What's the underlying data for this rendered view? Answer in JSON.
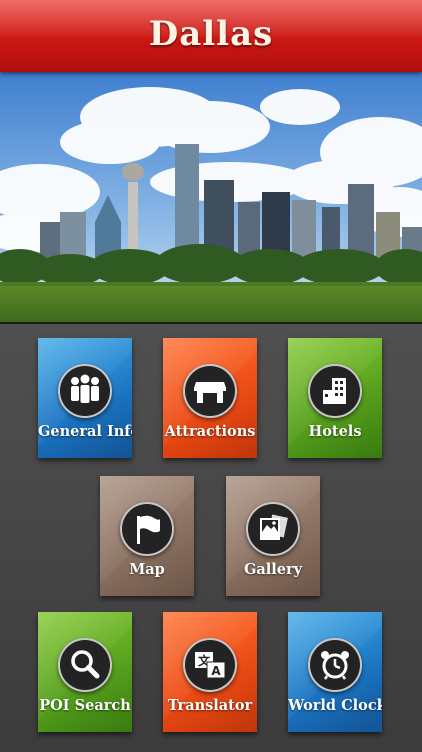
{
  "header": {
    "title": "Dallas"
  },
  "hero": {
    "alt": "Dallas skyline"
  },
  "tiles": [
    {
      "label": "General Info",
      "icon": "people-icon",
      "color": "#1f84d0"
    },
    {
      "label": "Attractions",
      "icon": "storefront-icon",
      "color": "#f05a1c"
    },
    {
      "label": "Hotels",
      "icon": "building-icon",
      "color": "#62ad22"
    },
    {
      "label": "Map",
      "icon": "flag-icon",
      "color": "#8f7666"
    },
    {
      "label": "Gallery",
      "icon": "photos-icon",
      "color": "#8f7666"
    },
    {
      "label": "POI Search",
      "icon": "magnifier-icon",
      "color": "#62ad22"
    },
    {
      "label": "Translator",
      "icon": "translate-icon",
      "color": "#f05a1c"
    },
    {
      "label": "World Clock",
      "icon": "alarm-clock-icon",
      "color": "#1f84d0"
    }
  ]
}
